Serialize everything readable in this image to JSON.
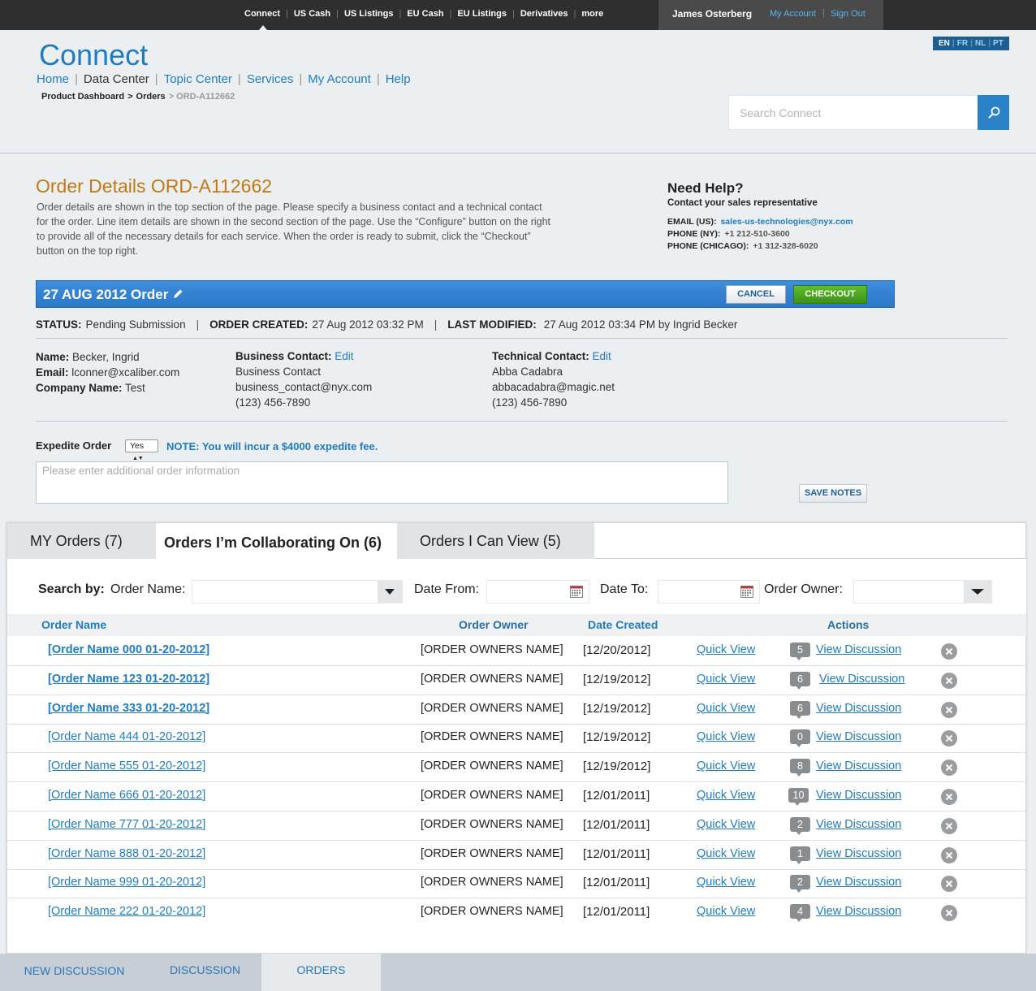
{
  "topnav": {
    "items": [
      "Connect",
      "US Cash",
      "US Listings",
      "EU Cash",
      "EU Listings",
      "Derivatives",
      "more"
    ],
    "user": "James Osterberg",
    "my_account": "My Account",
    "sign_out": "Sign Out",
    "sep": "|"
  },
  "header": {
    "logo": "Connect",
    "languages": [
      "EN",
      "FR",
      "NL",
      "PT"
    ],
    "nav": [
      "Home",
      "Data Center",
      "Topic Center",
      "Services",
      "My Account",
      "Help"
    ],
    "breadcrumb": {
      "part1": "Product Dashboard",
      "part2": "Orders",
      "current": "> ORD-A112662"
    },
    "search_placeholder": "Search Connect"
  },
  "order": {
    "title": "Order Details ORD-A112662",
    "description": "Order details are shown in the top section of the page. Please specify a business contact and a technical contact for the order. Line item details are shown in the second section of the page. Use the “Configure” button on the right to provide all of the necessary details for each service. When the order is ready to submit, click the “Checkout” button on the top right.",
    "bar_title": "27 AUG 2012 Order",
    "cancel": "CANCEL",
    "checkout": "CHECKOUT",
    "status_label": "STATUS:",
    "status_value": "Pending Submission",
    "created_label": "ORDER CREATED:",
    "created_value": "27 Aug 2012 03:32 PM",
    "modified_label": "LAST MODIFIED:",
    "modified_value": "27 Aug 2012 03:34 PM by Ingrid Becker",
    "name_label": "Name:",
    "name_value": "Becker, Ingrid",
    "email_label": "Email:",
    "email_value": "lconner@xcaliber.com",
    "company_label": "Company Name:",
    "company_value": "Test",
    "business": {
      "label": "Business Contact:",
      "edit": "Edit",
      "name": "Business Contact",
      "email": "business_contact@nyx.com",
      "phone": "(123) 456-7890"
    },
    "technical": {
      "label": "Technical Contact:",
      "edit": "Edit",
      "name": "Abba Cadabra",
      "email": "abbacadabra@magic.net",
      "phone": "(123) 456-7890"
    },
    "expedite_label": "Expedite Order",
    "expedite_value": "Yes",
    "expedite_note": "NOTE: You will incur a $4000 expedite fee.",
    "notes_placeholder": "Please enter additional order information",
    "save_notes": "SAVE NOTES"
  },
  "help": {
    "title": "Need Help?",
    "subtitle": "Contact your sales representative",
    "email_label": "EMAIL (US):",
    "email_value": "sales-us-technologies@nyx.com",
    "phone_ny_label": "PHONE (NY):",
    "phone_ny_value": "+1 212-510-3600",
    "phone_chi_label": "PHONE (CHICAGO):",
    "phone_chi_value": "+1 312-328-6020"
  },
  "orders_panel": {
    "tabs": [
      "MY Orders  (7)",
      "Orders I’m Collaborating On (6)",
      "Orders I Can View (5)"
    ],
    "search_by": "Search by:",
    "order_name_label": "Order Name:",
    "date_from_label": "Date From:",
    "date_to_label": "Date To:",
    "order_owner_label": "Order Owner:",
    "columns": {
      "name": "Order Name",
      "owner": "Order Owner",
      "date": "Date Created",
      "actions": "Actions"
    },
    "quick_view": "Quick View",
    "view_discussion": "View Discussion",
    "rows": [
      {
        "name": "[Order Name 000 01-20-2012]",
        "owner": "[ORDER OWNERS NAME]",
        "date": "[12/20/2012]",
        "count": "5"
      },
      {
        "name": "[Order Name 123 01-20-2012]",
        "owner": "[ORDER OWNERS NAME]",
        "date": "[12/19/2012]",
        "count": "6"
      },
      {
        "name": "[Order Name 333 01-20-2012]",
        "owner": "[ORDER OWNERS NAME]",
        "date": "[12/19/2012]",
        "count": "6"
      },
      {
        "name": "[Order Name 444 01-20-2012]",
        "owner": "[ORDER OWNERS NAME]",
        "date": "[12/19/2012]",
        "count": "0"
      },
      {
        "name": "[Order Name 555 01-20-2012]",
        "owner": "[ORDER OWNERS NAME]",
        "date": "[12/19/2012]",
        "count": "8"
      },
      {
        "name": "[Order Name 666 01-20-2012]",
        "owner": "[ORDER OWNERS NAME]",
        "date": "[12/01/2011]",
        "count": "10"
      },
      {
        "name": "[Order Name 777 01-20-2012]",
        "owner": "[ORDER OWNERS NAME]",
        "date": "[12/01/2011]",
        "count": "2"
      },
      {
        "name": "[Order Name 888 01-20-2012]",
        "owner": "[ORDER OWNERS NAME]",
        "date": "[12/01/2011]",
        "count": "1"
      },
      {
        "name": "[Order Name 999 01-20-2012]",
        "owner": "[ORDER OWNERS NAME]",
        "date": "[12/01/2011]",
        "count": "2"
      },
      {
        "name": "[Order Name 222 01-20-2012]",
        "owner": "[ORDER OWNERS NAME]",
        "date": "[12/01/2011]",
        "count": "4"
      }
    ]
  },
  "bottom_tabs": [
    "NEW DISCUSSION",
    "DISCUSSION",
    "ORDERS"
  ]
}
